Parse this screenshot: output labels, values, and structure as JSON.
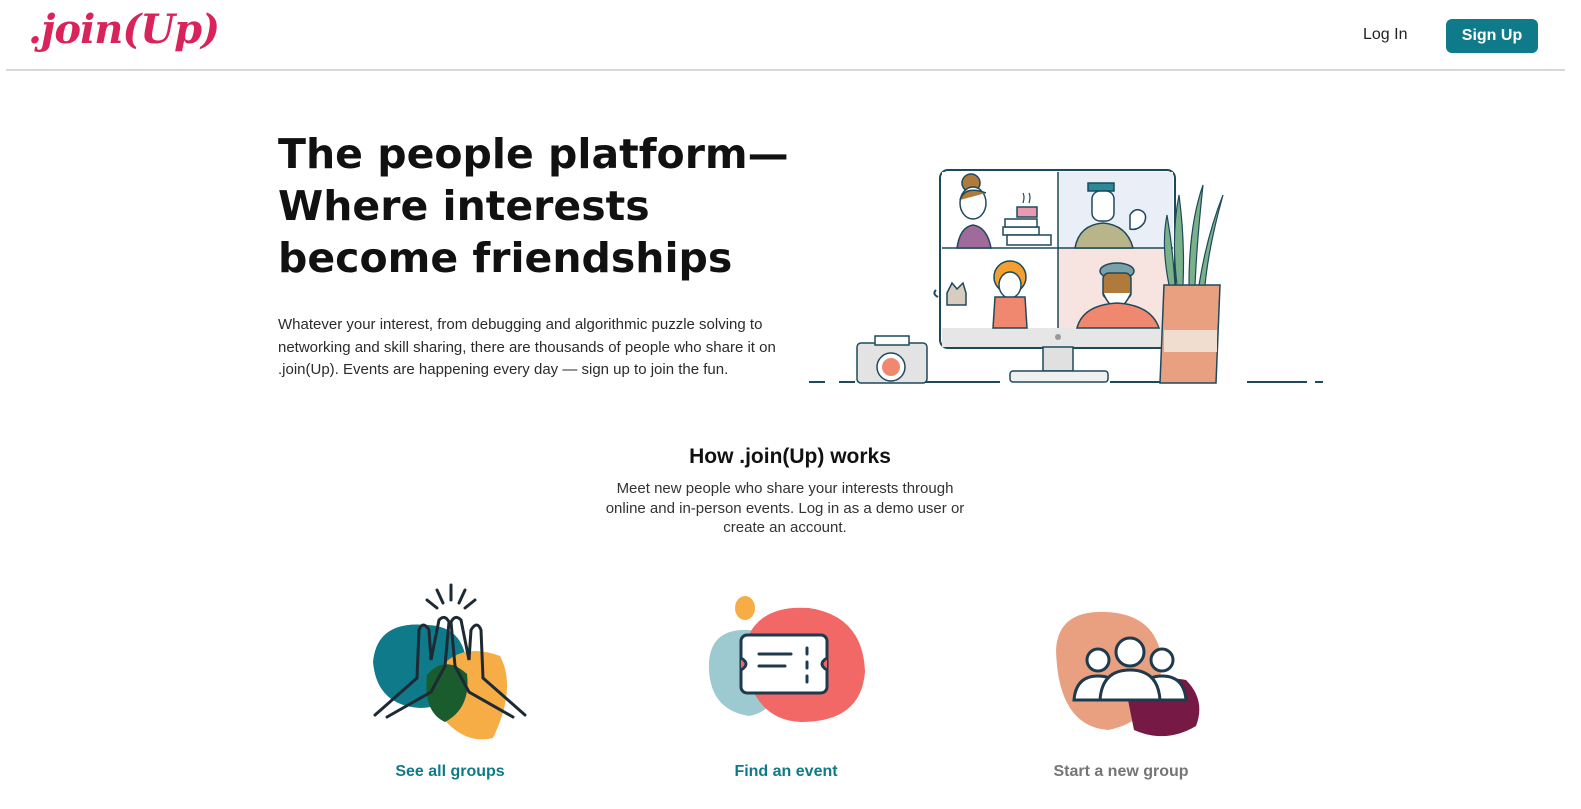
{
  "header": {
    "logo": ".join(Up)",
    "login_label": "Log In",
    "signup_label": "Sign Up"
  },
  "hero": {
    "title_lines": [
      "The people platform—",
      "Where interests",
      "become friendships"
    ],
    "description": "Whatever your interest, from debugging and algorithmic puzzle solving to networking and skill sharing, there are thousands of people who share it on .join(Up). Events are happening every day — sign up to join the fun."
  },
  "how": {
    "title": "How .join(Up) works",
    "description": "Meet new people who share your interests through online and in-person events. Log in as a demo user or create an account."
  },
  "cards": [
    {
      "label": "See all groups",
      "icon": "high-five-icon",
      "description": ""
    },
    {
      "label": "Find an event",
      "icon": "ticket-icon",
      "description": ""
    },
    {
      "label": "Start a new group",
      "icon": "people-group-icon",
      "description": ""
    }
  ],
  "colors": {
    "brand": "#d8245a",
    "accent": "#0f7a8a",
    "disabled": "#757575"
  }
}
